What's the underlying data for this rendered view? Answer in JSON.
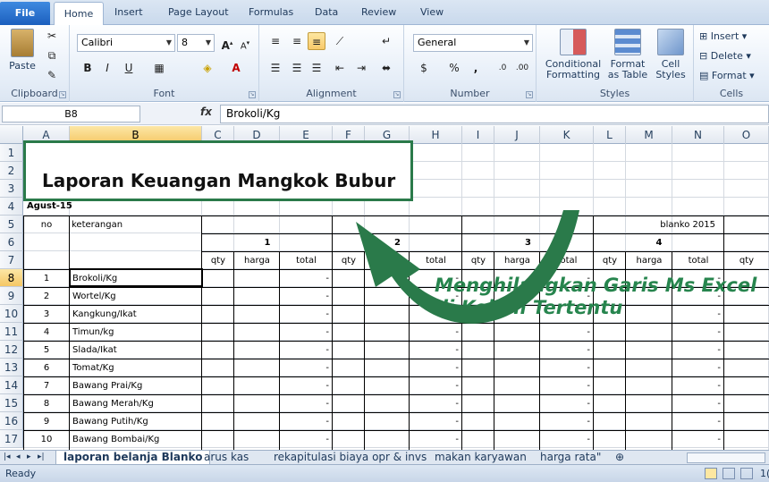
{
  "ribbon_tabs": {
    "file": "File",
    "home": "Home",
    "insert": "Insert",
    "page_layout": "Page Layout",
    "formulas": "Formulas",
    "data": "Data",
    "review": "Review",
    "view": "View"
  },
  "clipboard": {
    "paste": "Paste",
    "label": "Clipboard"
  },
  "font": {
    "name": "Calibri",
    "size": "8",
    "bold": "B",
    "italic": "I",
    "underline": "U",
    "label": "Font"
  },
  "alignment": {
    "label": "Alignment"
  },
  "number": {
    "format": "General",
    "percent": "%",
    "comma": ",",
    "label": "Number"
  },
  "styles": {
    "conditional_1": "Conditional",
    "conditional_2": "Formatting",
    "format_table_1": "Format",
    "format_table_2": "as Table",
    "cell_styles_1": "Cell",
    "cell_styles_2": "Styles",
    "label": "Styles"
  },
  "cells": {
    "insert": "Insert",
    "delete": "Delete",
    "format": "Format",
    "label": "Cells"
  },
  "formula_bar": {
    "name_box": "B8",
    "fx": "fx",
    "content": "Brokoli/Kg"
  },
  "columns": [
    "A",
    "B",
    "C",
    "D",
    "E",
    "F",
    "G",
    "H",
    "I",
    "J",
    "K",
    "L",
    "M",
    "N",
    "O"
  ],
  "rows": [
    "1",
    "2",
    "3",
    "4",
    "5",
    "6",
    "7",
    "8",
    "9",
    "10",
    "11",
    "12",
    "13",
    "14",
    "15",
    "16",
    "17"
  ],
  "sheet": {
    "title": "Laporan Keuangan Mangkok Bubur",
    "date": "Agust-15",
    "col_no": "no",
    "col_keterangan": "keterangan",
    "blanko": "blanko 2015",
    "week_numbers": [
      "1",
      "2",
      "3",
      "4"
    ],
    "sub_headers": {
      "qty": "qty",
      "harga": "harga",
      "total": "total"
    },
    "dash": "-",
    "items": [
      {
        "no": "1",
        "name": "Brokoli/Kg"
      },
      {
        "no": "2",
        "name": "Wortel/Kg"
      },
      {
        "no": "3",
        "name": "Kangkung/Ikat"
      },
      {
        "no": "4",
        "name": "Timun/kg"
      },
      {
        "no": "5",
        "name": "Slada/Ikat"
      },
      {
        "no": "6",
        "name": "Tomat/Kg"
      },
      {
        "no": "7",
        "name": "Bawang Prai/Kg"
      },
      {
        "no": "8",
        "name": "Bawang Merah/Kg"
      },
      {
        "no": "9",
        "name": "Bawang Putih/Kg"
      },
      {
        "no": "10",
        "name": "Bawang Bombai/Kg"
      }
    ]
  },
  "annotation": {
    "line1": "Menghilangkan Garis Ms Excel",
    "line2": "di Kolom Tertentu",
    "color": "#27854e"
  },
  "sheet_tabs": [
    "laporan belanja Blanko",
    "arus kas",
    "rekapitulasi biaya opr & invs",
    "makan karyawan",
    "harga rata\""
  ],
  "status": "Ready",
  "zoom_partial": "1("
}
